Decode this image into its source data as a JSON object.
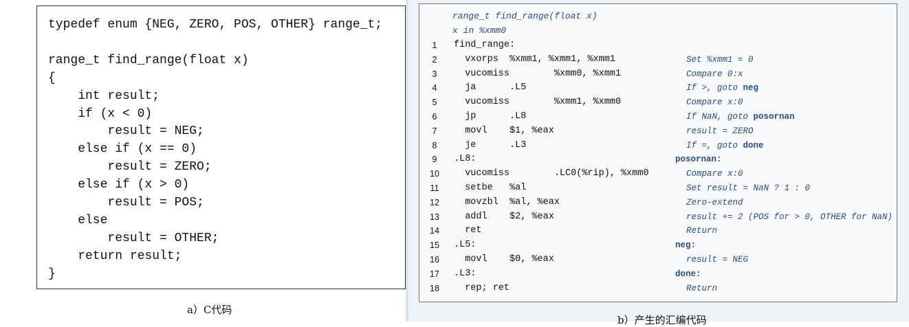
{
  "c_code": {
    "lines": [
      "typedef enum {NEG, ZERO, POS, OTHER} range_t;",
      "",
      "range_t find_range(float x)",
      "{",
      "    int result;",
      "    if (x < 0)",
      "        result = NEG;",
      "    else if (x == 0)",
      "        result = ZERO;",
      "    else if (x > 0)",
      "        result = POS;",
      "    else",
      "        result = OTHER;",
      "    return result;",
      "}"
    ],
    "caption": "a）C代码"
  },
  "asm": {
    "header": [
      "range_t find_range(float x)",
      "x in %xmm0"
    ],
    "lines": [
      {
        "n": "1",
        "code": "find_range:",
        "comment": "",
        "label": ""
      },
      {
        "n": "2",
        "code": "  vxorps  %xmm1, %xmm1, %xmm1",
        "comment": "Set %xmm1 = 0",
        "label": ""
      },
      {
        "n": "3",
        "code": "  vucomiss        %xmm0, %xmm1",
        "comment": "Compare 0:x",
        "label": ""
      },
      {
        "n": "4",
        "code": "  ja      .L5",
        "comment": "If >, goto ",
        "commentKeyword": "neg",
        "label": ""
      },
      {
        "n": "5",
        "code": "  vucomiss        %xmm1, %xmm0",
        "comment": "Compare x:0",
        "label": ""
      },
      {
        "n": "6",
        "code": "  jp      .L8",
        "comment": "If NaN, goto ",
        "commentKeyword": "posornan",
        "label": ""
      },
      {
        "n": "7",
        "code": "  movl    $1, %eax",
        "comment": "result = ZERO",
        "label": ""
      },
      {
        "n": "8",
        "code": "  je      .L3",
        "comment": "If =, goto ",
        "commentKeyword": "done",
        "label": ""
      },
      {
        "n": "9",
        "code": ".L8:",
        "comment": "",
        "label": "posornan:"
      },
      {
        "n": "10",
        "code": "  vucomiss        .LC0(%rip), %xmm0",
        "comment": "Compare x:0",
        "label": ""
      },
      {
        "n": "11",
        "code": "  setbe   %al",
        "comment": "Set result = NaN ? 1 : 0",
        "label": ""
      },
      {
        "n": "12",
        "code": "  movzbl  %al, %eax",
        "comment": "Zero-extend",
        "label": ""
      },
      {
        "n": "13",
        "code": "  addl    $2, %eax",
        "comment": "result += 2 (POS for > 0, OTHER for NaN)",
        "label": ""
      },
      {
        "n": "14",
        "code": "  ret",
        "comment": "Return",
        "label": ""
      },
      {
        "n": "15",
        "code": ".L5:",
        "comment": "",
        "label": "neg:"
      },
      {
        "n": "16",
        "code": "  movl    $0, %eax",
        "comment": "result = NEG",
        "label": ""
      },
      {
        "n": "17",
        "code": ".L3:",
        "comment": "",
        "label": "done:"
      },
      {
        "n": "18",
        "code": "  rep; ret",
        "comment": "Return",
        "label": ""
      }
    ],
    "caption": "b）产生的汇编代码"
  }
}
